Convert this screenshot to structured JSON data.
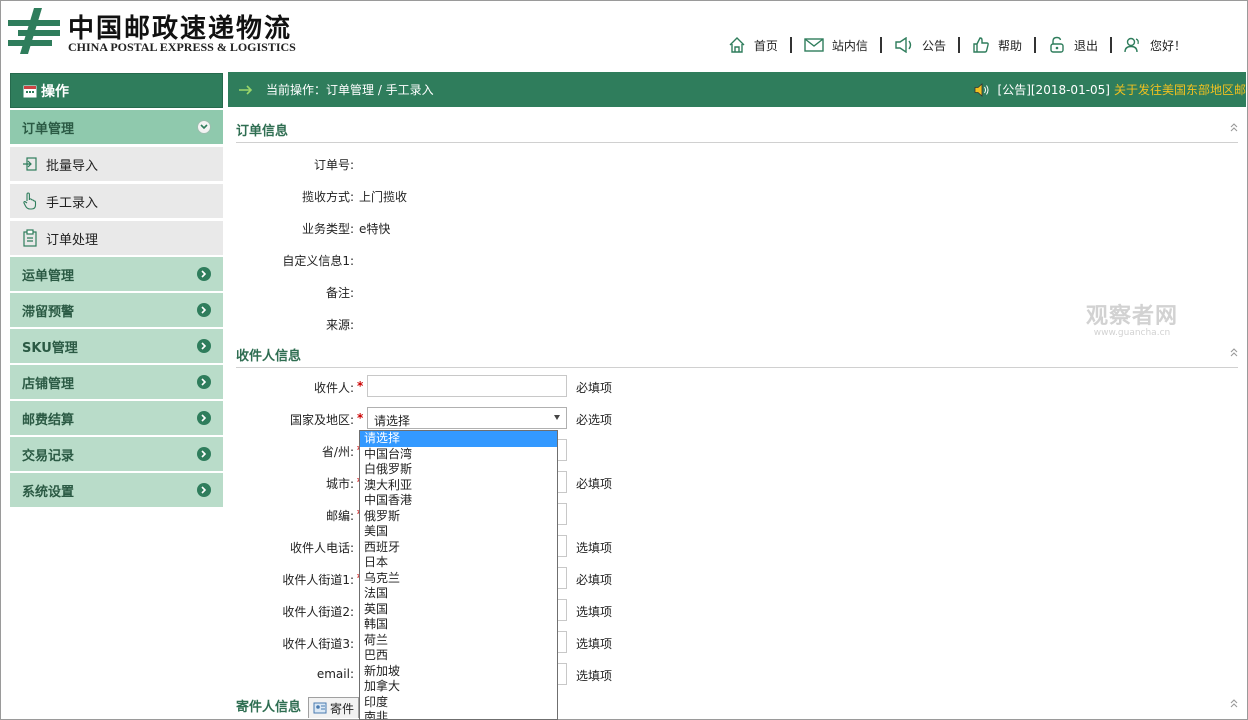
{
  "header": {
    "logo_cn": "中国邮政速递物流",
    "logo_en": "CHINA POSTAL EXPRESS & LOGISTICS",
    "nav": [
      {
        "label": "首页",
        "icon": "home-icon"
      },
      {
        "label": "站内信",
        "icon": "mail-icon"
      },
      {
        "label": "公告",
        "icon": "megaphone-icon"
      },
      {
        "label": "帮助",
        "icon": "thumb-up-icon"
      },
      {
        "label": "退出",
        "icon": "lock-icon"
      },
      {
        "label": "您好！",
        "icon": "user-icon"
      }
    ]
  },
  "sidebar": {
    "title": "操作",
    "groups": [
      {
        "label": "订单管理",
        "expanded": true
      },
      {
        "label": "运单管理"
      },
      {
        "label": "滞留预警"
      },
      {
        "label": "SKU管理"
      },
      {
        "label": "店铺管理"
      },
      {
        "label": "邮费结算"
      },
      {
        "label": "交易记录"
      },
      {
        "label": "系统设置"
      }
    ],
    "subitems": [
      {
        "label": "批量导入",
        "icon": "import-icon"
      },
      {
        "label": "手工录入",
        "icon": "hand-pointer-icon"
      },
      {
        "label": "订单处理",
        "icon": "clipboard-icon"
      }
    ]
  },
  "topbar": {
    "breadcrumb": "当前操作：订单管理 / 手工录入",
    "notice_label": "[公告][2018-01-05]",
    "notice_link": "关于发往美国东部地区邮"
  },
  "order_info": {
    "title": "订单信息",
    "fields": [
      {
        "label": "订单号:",
        "value": ""
      },
      {
        "label": "揽收方式:",
        "value": "上门揽收"
      },
      {
        "label": "业务类型:",
        "value": "e特快"
      },
      {
        "label": "自定义信息1:",
        "value": ""
      },
      {
        "label": "备注:",
        "value": ""
      },
      {
        "label": "来源:",
        "value": ""
      }
    ]
  },
  "recipient_info": {
    "title": "收件人信息",
    "fields": [
      {
        "label": "收件人:",
        "hint": "必填项"
      },
      {
        "label": "国家及地区:",
        "hint": "必选项",
        "select_value": "请选择"
      },
      {
        "label": "省/州:",
        "hint": ""
      },
      {
        "label": "城市:",
        "hint": "必填项"
      },
      {
        "label": "邮编:",
        "hint": ""
      },
      {
        "label": "收件人电话:",
        "hint": "选填项"
      },
      {
        "label": "收件人街道1:",
        "hint": "必填项"
      },
      {
        "label": "收件人街道2:",
        "hint": "选填项"
      },
      {
        "label": "收件人街道3:",
        "hint": "选填项"
      },
      {
        "label": "email:",
        "hint": "选填项"
      }
    ]
  },
  "country_options": [
    "请选择",
    "中国台湾",
    "白俄罗斯",
    "澳大利亚",
    "中国香港",
    "俄罗斯",
    "美国",
    "西班牙",
    "日本",
    "乌克兰",
    "法国",
    "英国",
    "韩国",
    "荷兰",
    "巴西",
    "新加坡",
    "加拿大",
    "印度",
    "南非"
  ],
  "sender_info": {
    "title": "寄件人信息",
    "button": "寄件"
  },
  "watermark": {
    "line1": "观察者网",
    "line2": "www.guancha.cn"
  },
  "colors": {
    "primary": "#2f7d5c",
    "accent": "#f0c020",
    "required": "#cc0000"
  }
}
